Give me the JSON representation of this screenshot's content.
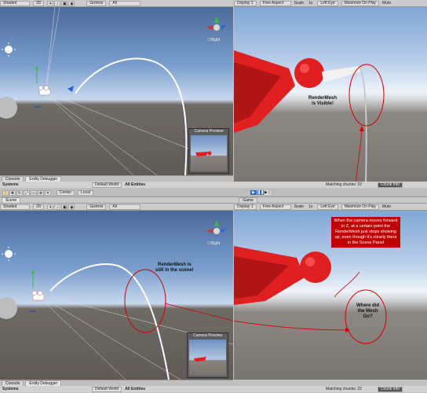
{
  "top": {
    "scene_toolbar": {
      "shading": "Shaded",
      "mode_2d": "2D",
      "gizmos": "Gizmos",
      "search": "All"
    },
    "game_toolbar": {
      "display": "Display 1",
      "aspect": "Free Aspect",
      "scale_label": "Scale",
      "scale_value": "1x",
      "left_eye": "Left Eye",
      "maximize": "Maximize On Play",
      "mute": "Mute"
    },
    "persp_label": "☐Right",
    "camera_preview": "Camera Preview",
    "annotation": "RenderMesh\nis Visible!",
    "console_tabs": [
      "Console",
      "Entity Debugger"
    ],
    "systems_label": "Systems",
    "default_world": "Default World",
    "all_entities": "All Entities",
    "matching_chunks": "Matching chunks: 22",
    "chunk_info": "Chunk Info"
  },
  "toolbar_mid": {
    "center": "Center",
    "local": "Local",
    "scene_tab": "Scene",
    "game_tab": "Game"
  },
  "bottom": {
    "scene_toolbar": {
      "shading": "Shaded",
      "mode_2d": "2D",
      "gizmos": "Gizmos",
      "search": "All"
    },
    "game_toolbar": {
      "display": "Display 1",
      "aspect": "Free Aspect",
      "scale_label": "Scale",
      "scale_value": "1x",
      "left_eye": "Left Eye",
      "maximize": "Maximize On Play",
      "mute": "Mute"
    },
    "persp_label": "☐Right",
    "camera_preview": "Camera Preview",
    "annotation_scene": "RenderMesh is\nstill in the scene!",
    "annotation_red": "When the camera moves forward in Z, at a certain point the RenderMesh just stops showing up, even though it's clearly there in the Scene Panel",
    "annotation_where": "Where did\nthe Mesh\nGo?",
    "console_tabs": [
      "Console",
      "Entity Debugger"
    ],
    "systems_label": "Systems",
    "default_world": "Default World",
    "all_entities": "All Entities",
    "matching_chunks": "Matching chunks: 22",
    "chunk_info": "Chunk Info"
  },
  "colors": {
    "annotation_red": "#d00000",
    "label_bg": "#c00000",
    "mesh_red": "#e02020"
  }
}
